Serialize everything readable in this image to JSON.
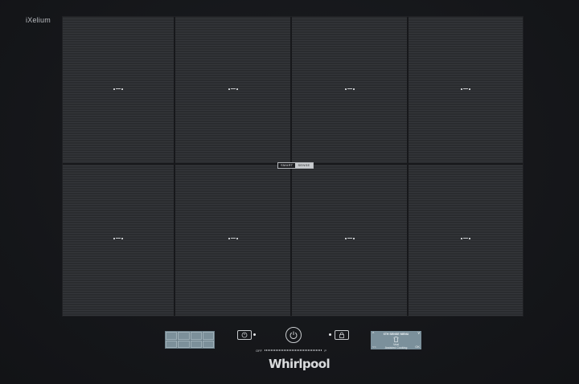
{
  "brand_top": "iXelium",
  "smart_badge": {
    "part1": "SMART",
    "part2": "SENSE"
  },
  "display": {
    "menu_title": "6TH SENSE MENU",
    "dish_label": "Veal",
    "dish_sub": "Assisted Cooking",
    "nav_up": "^",
    "nav_down": "v",
    "nav_back": "<<",
    "nav_ok": "OK"
  },
  "slider": {
    "off_label": "OFF",
    "max_label": "P",
    "level": 0.0
  },
  "logo_text": "Whirlpool",
  "colors": {
    "surface": "#2b2d30",
    "display_bg": "#7b909b",
    "frame": "#141519"
  }
}
